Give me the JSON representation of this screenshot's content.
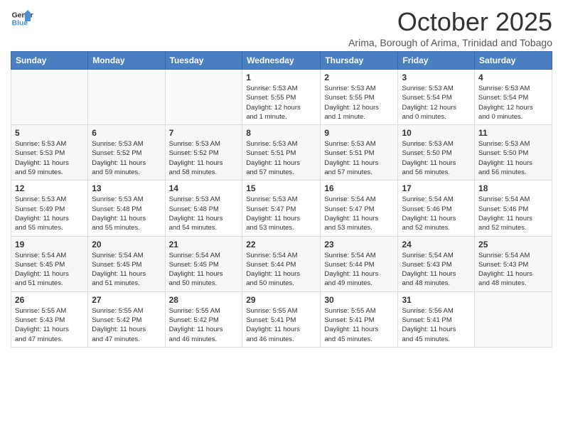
{
  "header": {
    "logo_line1": "General",
    "logo_line2": "Blue",
    "month_title": "October 2025",
    "subtitle": "Arima, Borough of Arima, Trinidad and Tobago"
  },
  "weekdays": [
    "Sunday",
    "Monday",
    "Tuesday",
    "Wednesday",
    "Thursday",
    "Friday",
    "Saturday"
  ],
  "weeks": [
    [
      {
        "day": "",
        "info": ""
      },
      {
        "day": "",
        "info": ""
      },
      {
        "day": "",
        "info": ""
      },
      {
        "day": "1",
        "info": "Sunrise: 5:53 AM\nSunset: 5:55 PM\nDaylight: 12 hours\nand 1 minute."
      },
      {
        "day": "2",
        "info": "Sunrise: 5:53 AM\nSunset: 5:55 PM\nDaylight: 12 hours\nand 1 minute."
      },
      {
        "day": "3",
        "info": "Sunrise: 5:53 AM\nSunset: 5:54 PM\nDaylight: 12 hours\nand 0 minutes."
      },
      {
        "day": "4",
        "info": "Sunrise: 5:53 AM\nSunset: 5:54 PM\nDaylight: 12 hours\nand 0 minutes."
      }
    ],
    [
      {
        "day": "5",
        "info": "Sunrise: 5:53 AM\nSunset: 5:53 PM\nDaylight: 11 hours\nand 59 minutes."
      },
      {
        "day": "6",
        "info": "Sunrise: 5:53 AM\nSunset: 5:52 PM\nDaylight: 11 hours\nand 59 minutes."
      },
      {
        "day": "7",
        "info": "Sunrise: 5:53 AM\nSunset: 5:52 PM\nDaylight: 11 hours\nand 58 minutes."
      },
      {
        "day": "8",
        "info": "Sunrise: 5:53 AM\nSunset: 5:51 PM\nDaylight: 11 hours\nand 57 minutes."
      },
      {
        "day": "9",
        "info": "Sunrise: 5:53 AM\nSunset: 5:51 PM\nDaylight: 11 hours\nand 57 minutes."
      },
      {
        "day": "10",
        "info": "Sunrise: 5:53 AM\nSunset: 5:50 PM\nDaylight: 11 hours\nand 56 minutes."
      },
      {
        "day": "11",
        "info": "Sunrise: 5:53 AM\nSunset: 5:50 PM\nDaylight: 11 hours\nand 56 minutes."
      }
    ],
    [
      {
        "day": "12",
        "info": "Sunrise: 5:53 AM\nSunset: 5:49 PM\nDaylight: 11 hours\nand 55 minutes."
      },
      {
        "day": "13",
        "info": "Sunrise: 5:53 AM\nSunset: 5:48 PM\nDaylight: 11 hours\nand 55 minutes."
      },
      {
        "day": "14",
        "info": "Sunrise: 5:53 AM\nSunset: 5:48 PM\nDaylight: 11 hours\nand 54 minutes."
      },
      {
        "day": "15",
        "info": "Sunrise: 5:53 AM\nSunset: 5:47 PM\nDaylight: 11 hours\nand 53 minutes."
      },
      {
        "day": "16",
        "info": "Sunrise: 5:54 AM\nSunset: 5:47 PM\nDaylight: 11 hours\nand 53 minutes."
      },
      {
        "day": "17",
        "info": "Sunrise: 5:54 AM\nSunset: 5:46 PM\nDaylight: 11 hours\nand 52 minutes."
      },
      {
        "day": "18",
        "info": "Sunrise: 5:54 AM\nSunset: 5:46 PM\nDaylight: 11 hours\nand 52 minutes."
      }
    ],
    [
      {
        "day": "19",
        "info": "Sunrise: 5:54 AM\nSunset: 5:45 PM\nDaylight: 11 hours\nand 51 minutes."
      },
      {
        "day": "20",
        "info": "Sunrise: 5:54 AM\nSunset: 5:45 PM\nDaylight: 11 hours\nand 51 minutes."
      },
      {
        "day": "21",
        "info": "Sunrise: 5:54 AM\nSunset: 5:45 PM\nDaylight: 11 hours\nand 50 minutes."
      },
      {
        "day": "22",
        "info": "Sunrise: 5:54 AM\nSunset: 5:44 PM\nDaylight: 11 hours\nand 50 minutes."
      },
      {
        "day": "23",
        "info": "Sunrise: 5:54 AM\nSunset: 5:44 PM\nDaylight: 11 hours\nand 49 minutes."
      },
      {
        "day": "24",
        "info": "Sunrise: 5:54 AM\nSunset: 5:43 PM\nDaylight: 11 hours\nand 48 minutes."
      },
      {
        "day": "25",
        "info": "Sunrise: 5:54 AM\nSunset: 5:43 PM\nDaylight: 11 hours\nand 48 minutes."
      }
    ],
    [
      {
        "day": "26",
        "info": "Sunrise: 5:55 AM\nSunset: 5:43 PM\nDaylight: 11 hours\nand 47 minutes."
      },
      {
        "day": "27",
        "info": "Sunrise: 5:55 AM\nSunset: 5:42 PM\nDaylight: 11 hours\nand 47 minutes."
      },
      {
        "day": "28",
        "info": "Sunrise: 5:55 AM\nSunset: 5:42 PM\nDaylight: 11 hours\nand 46 minutes."
      },
      {
        "day": "29",
        "info": "Sunrise: 5:55 AM\nSunset: 5:41 PM\nDaylight: 11 hours\nand 46 minutes."
      },
      {
        "day": "30",
        "info": "Sunrise: 5:55 AM\nSunset: 5:41 PM\nDaylight: 11 hours\nand 45 minutes."
      },
      {
        "day": "31",
        "info": "Sunrise: 5:56 AM\nSunset: 5:41 PM\nDaylight: 11 hours\nand 45 minutes."
      },
      {
        "day": "",
        "info": ""
      }
    ]
  ]
}
